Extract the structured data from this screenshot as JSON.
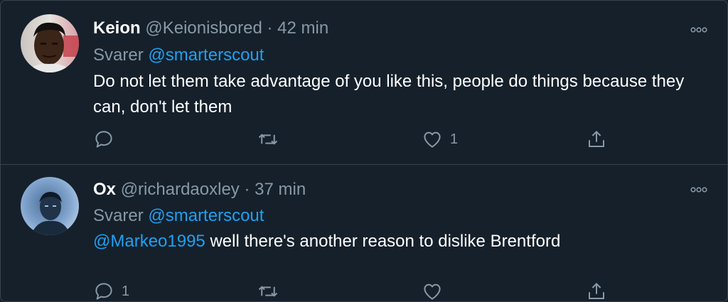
{
  "tweets": [
    {
      "name": "Keion",
      "handle": "@Keionisbored",
      "time": "42 min",
      "reply_prefix": "Svarer",
      "reply_to": "@smarterscout",
      "text_mention": "",
      "text": "Do not let them take advantage of you like this, people do things because they can, don't let them",
      "reply_count": "",
      "retweet_count": "",
      "like_count": "1"
    },
    {
      "name": "Ox",
      "handle": "@richardaoxley",
      "time": "37 min",
      "reply_prefix": "Svarer",
      "reply_to": "@smarterscout",
      "text_mention": "@Markeo1995",
      "text": " well there's another reason to dislike Brentford",
      "reply_count": "1",
      "retweet_count": "",
      "like_count": ""
    }
  ],
  "separator": "·",
  "colors": {
    "background": "#15202b",
    "secondary_text": "#8899a6",
    "accent": "#1da1f2",
    "border": "#38444d"
  }
}
